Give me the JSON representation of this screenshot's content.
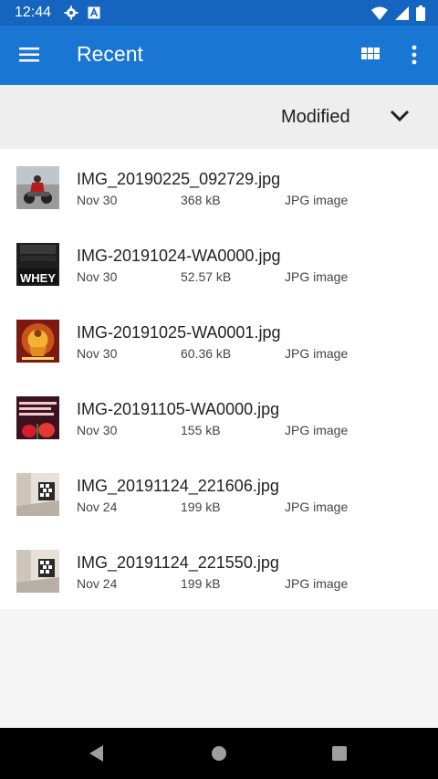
{
  "status_bar": {
    "time": "12:44",
    "icons": [
      "gear-icon",
      "a-box-icon",
      "wifi-icon",
      "signal-icon",
      "battery-icon"
    ]
  },
  "app_bar": {
    "title": "Recent",
    "background": "#1976d2",
    "icons": [
      "hamburger-icon",
      "grid-view-icon",
      "more-vert-icon"
    ]
  },
  "sort_bar": {
    "label": "Modified",
    "icon": "chevron-down-icon"
  },
  "files": [
    {
      "name": "IMG_20190225_092729.jpg",
      "date": "Nov 30",
      "size": "368 kB",
      "type": "JPG image"
    },
    {
      "name": "IMG-20191024-WA0000.jpg",
      "date": "Nov 30",
      "size": "52.57 kB",
      "type": "JPG image"
    },
    {
      "name": "IMG-20191025-WA0001.jpg",
      "date": "Nov 30",
      "size": "60.36 kB",
      "type": "JPG image"
    },
    {
      "name": "IMG-20191105-WA0000.jpg",
      "date": "Nov 30",
      "size": "155 kB",
      "type": "JPG image"
    },
    {
      "name": "IMG_20191124_221606.jpg",
      "date": "Nov 24",
      "size": "199 kB",
      "type": "JPG image"
    },
    {
      "name": "IMG_20191124_221550.jpg",
      "date": "Nov 24",
      "size": "199 kB",
      "type": "JPG image"
    }
  ],
  "thumbnails": {
    "thumb_1_text": "",
    "thumb_2_text": "WHEY"
  },
  "nav_bar": {
    "icons": [
      "back-icon",
      "home-icon",
      "recents-icon"
    ]
  }
}
